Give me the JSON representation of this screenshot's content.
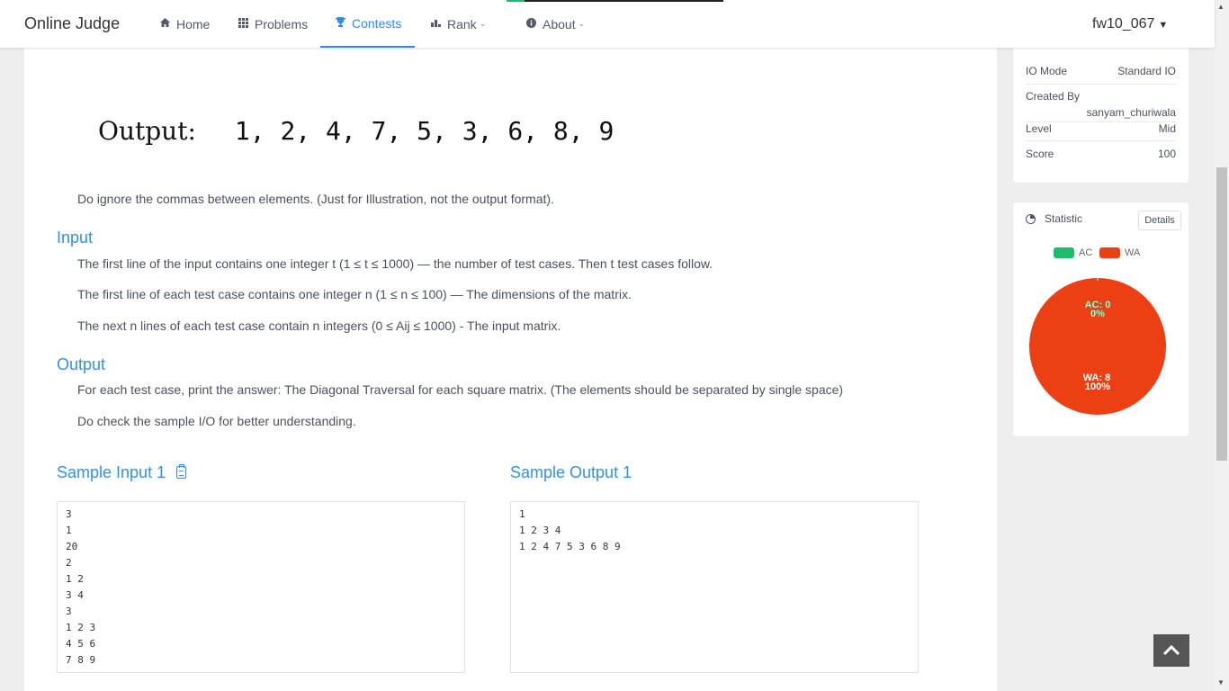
{
  "header": {
    "brand": "Online Judge",
    "nav": [
      {
        "label": "Home",
        "icon": "home-icon"
      },
      {
        "label": "Problems",
        "icon": "grid-icon"
      },
      {
        "label": "Contests",
        "icon": "trophy-icon",
        "active": true
      },
      {
        "label": "Rank",
        "icon": "bar-chart-icon"
      },
      {
        "label": "About",
        "icon": "info-icon"
      }
    ],
    "user": "fw10_067"
  },
  "problem": {
    "illustration": {
      "label": "Output:",
      "sequence": "1, 2, 4, 7, 5, 3, 6, 8, 9"
    },
    "ignore_note": "Do ignore the commas between elements. (Just for Illustration, not the output format).",
    "input_title": "Input",
    "input_lines": [
      "The first line of the input contains one integer t (1 ≤ t ≤ 1000) — the number of test cases. Then t test cases follow.",
      "The first line of each test case contains one integer n (1 ≤ n ≤ 100) — The dimensions of the matrix.",
      "The next n lines of each test case contain n integers (0 ≤ Aij ≤ 1000) - The input matrix."
    ],
    "output_title": "Output",
    "output_lines": [
      "For each test case, print the answer: The Diagonal Traversal for each square matrix. (The elements should be separated by single space)",
      "Do check the sample I/O for better understanding."
    ],
    "sample_input_title": "Sample Input 1",
    "sample_output_title": "Sample Output 1",
    "sample_input": "3\n1\n20\n2\n1 2\n3 4\n3\n1 2 3\n4 5 6\n7 8 9",
    "sample_output": "1\n1 2 3 4\n1 2 4 7 5 3 6 8 9"
  },
  "info": {
    "io_mode_label": "IO Mode",
    "io_mode_value": "Standard IO",
    "created_by_label": "Created By",
    "created_by_value": "sanyam_churiwala",
    "level_label": "Level",
    "level_value": "Mid",
    "score_label": "Score",
    "score_value": "100"
  },
  "statistic": {
    "title": "Statistic",
    "details_label": "Details",
    "legend": [
      {
        "name": "AC",
        "color": "#19be6b"
      },
      {
        "name": "WA",
        "color": "#ed3f14"
      }
    ],
    "ac_label": "AC: 0",
    "ac_percent": "0%",
    "wa_label": "WA: 8",
    "wa_percent": "100%"
  }
}
